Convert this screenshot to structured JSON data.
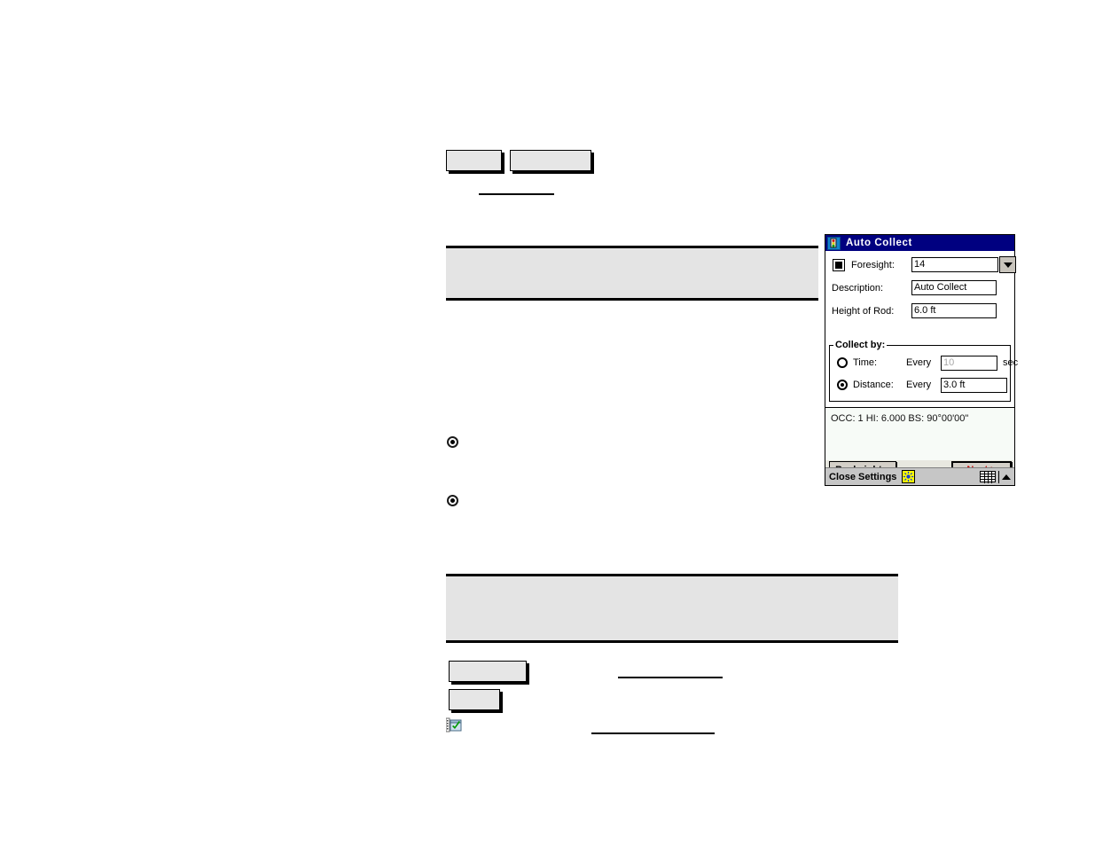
{
  "document": {
    "placeholders": {
      "small_button_a": "",
      "small_button_b": "",
      "note_box_top": "",
      "note_box_bottom": "",
      "button_wide": "",
      "button_narrow": "",
      "link_a": "",
      "link_b": "",
      "link_c": "",
      "bullet_one": "",
      "bullet_two": ""
    },
    "icons": {
      "document_check": "document-check-icon"
    }
  },
  "dialog": {
    "title": "Auto Collect",
    "title_icon": "traffic-light-icon",
    "fields": [
      {
        "label": "Foresight:",
        "value": "14",
        "has_marker": true,
        "has_dropdown": true
      },
      {
        "label": "Description:",
        "value": "Auto Collect",
        "has_marker": false,
        "has_dropdown": false
      },
      {
        "label": "Height of Rod:",
        "value": "6.0 ft",
        "has_marker": false,
        "has_dropdown": false
      }
    ],
    "collect_by": {
      "group_label": "Collect by:",
      "options": [
        {
          "label": "Time:",
          "selected": false,
          "every_label": "Every",
          "value": "10",
          "unit": "sec",
          "enabled": false
        },
        {
          "label": "Distance:",
          "selected": true,
          "every_label": "Every",
          "value": "3.0 ft",
          "unit": "",
          "enabled": true
        }
      ]
    },
    "status_line": "OCC: 1  HI: 6.000  BS: 90°00'00\"",
    "buttons": {
      "backsight": "Backsight...",
      "next": "Next >"
    },
    "taskbar": {
      "close_settings": "Close Settings",
      "sun_icon": "sun-icon",
      "keyboard_icon": "keyboard-icon",
      "up_arrow_icon": "chevron-up-icon"
    }
  },
  "colors": {
    "titlebar": "#000080",
    "dialog_face": "#d4d0c8",
    "note_box": "#e4e4e4",
    "default_button_text": "#c00000",
    "sun_icon": "#ffff00"
  }
}
